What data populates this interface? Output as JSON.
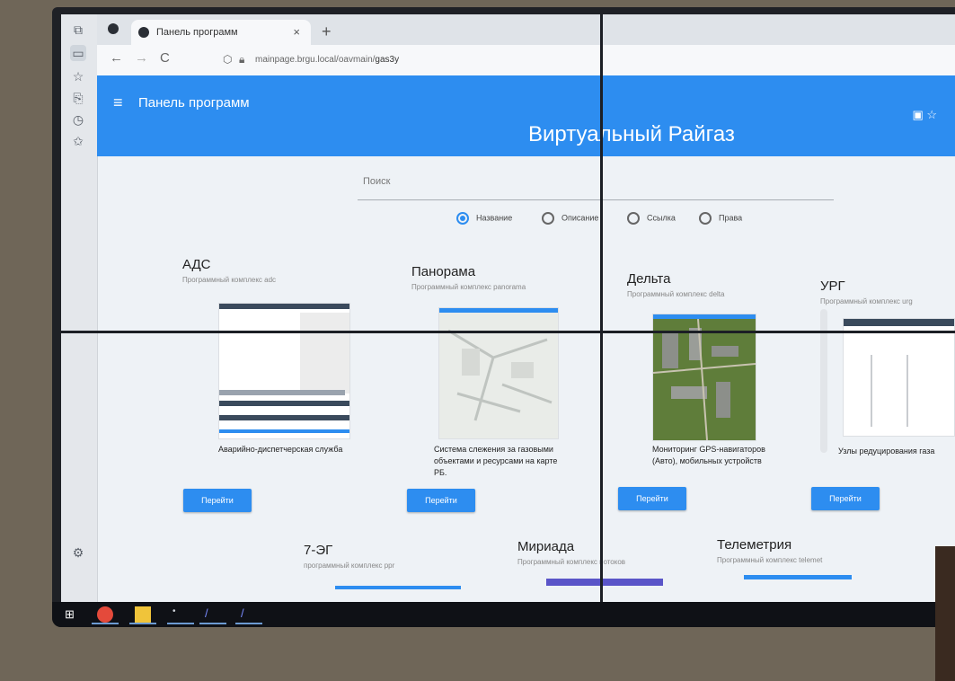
{
  "browser": {
    "tab_title": "Панель программ",
    "tab_close": "×",
    "new_tab": "+",
    "url_prefix": "mainpage.brgu.local/oavmain/",
    "url_path": "gas3y",
    "back": "←",
    "forward": "→",
    "reload": "C"
  },
  "header": {
    "menu_icon": "≡",
    "app_title": "Панель программ",
    "page_title": "Виртуальный Райгаз",
    "right_icons": "▣ ☆"
  },
  "search": {
    "placeholder": "Поиск"
  },
  "filters": [
    {
      "label": "Название",
      "selected": true
    },
    {
      "label": "Описание",
      "selected": false
    },
    {
      "label": "Ссылка",
      "selected": false
    },
    {
      "label": "Права",
      "selected": false
    }
  ],
  "cards": [
    {
      "title": "АДС",
      "subtitle": "Программный комплекс adc",
      "description": "Аварийно-диспетчерская служба",
      "button": "Перейти"
    },
    {
      "title": "Панорама",
      "subtitle": "Программный комплекс panorama",
      "description": "Система слежения за газовыми объектами и ресурсами на карте РБ.",
      "button": "Перейти"
    },
    {
      "title": "Дельта",
      "subtitle": "Программный комплекс delta",
      "description": "Мониторинг GPS-навигаторов (Авто), мобильных устройств",
      "button": "Перейти"
    },
    {
      "title": "УРГ",
      "subtitle": "Программный комплекс urg",
      "description": "Узлы редуцирования газа",
      "button": "Перейти"
    },
    {
      "title": "7-ЭГ",
      "subtitle": "программный комплекс ppr"
    },
    {
      "title": "Мириада",
      "subtitle": "Программный комплекс потоков"
    },
    {
      "title": "Телеметрия",
      "subtitle": "Программный комплекс telemet"
    }
  ],
  "colors": {
    "accent": "#2d8df0",
    "background": "#eef2f6"
  }
}
